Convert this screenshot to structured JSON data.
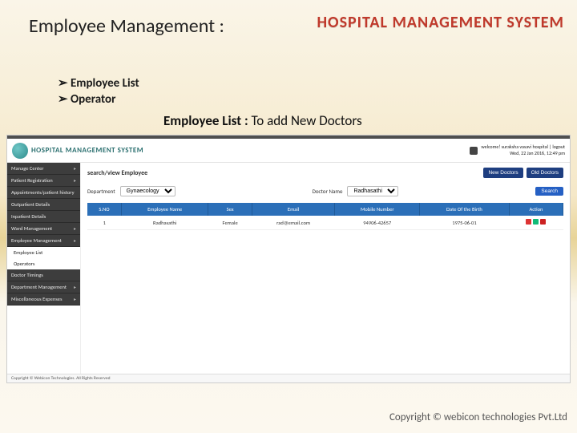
{
  "slide": {
    "title": "Employee Management :",
    "brand": "HOSPITAL MANAGEMENT SYSTEM",
    "bullets": [
      "Employee List",
      "Operator"
    ],
    "section_bold": "Employee List : ",
    "section_rest": "To add New Doctors",
    "copyright": "Copyright © webicon technologies Pvt.Ltd"
  },
  "app": {
    "brand": "HOSPITAL MANAGEMENT SYSTEM",
    "user": {
      "welcome": "welcome! suraksha vasavi hospital | logout",
      "time": "Wed, 22 Jan 2016, 12:49 pm"
    },
    "sidebar": {
      "dark": [
        "Manage Center",
        "Patient Registration",
        "Appointments/patient history",
        "Outpatient Details",
        "Inpatient Details",
        "Ward Management",
        "Employee Management"
      ],
      "light": [
        "Employee List",
        "Operators"
      ],
      "dark2": [
        "Doctor Timings",
        "Department Management",
        "Miscellaneous Expenses"
      ]
    },
    "main": {
      "title": "search/view Employee",
      "buttons": {
        "new": "New Doctors",
        "old": "Old Doctors"
      },
      "filters": {
        "dept_label": "Department",
        "dept_value": "Gynaecology",
        "name_label": "Doctor Name",
        "name_value": "Radhasathi",
        "search": "Search"
      },
      "columns": [
        "S.NO",
        "Employee Name",
        "Sex",
        "Email",
        "Mobile Number",
        "Date Of the Birth",
        "Action"
      ],
      "rows": [
        {
          "sno": "1",
          "name": "Radhasathi",
          "sex": "Female",
          "email": "rad@email.com",
          "mobile": "94906-42657",
          "dob": "1975-06-01"
        }
      ]
    },
    "footer": "Copyright © Webicon Technologies. All Rights Reserved"
  }
}
